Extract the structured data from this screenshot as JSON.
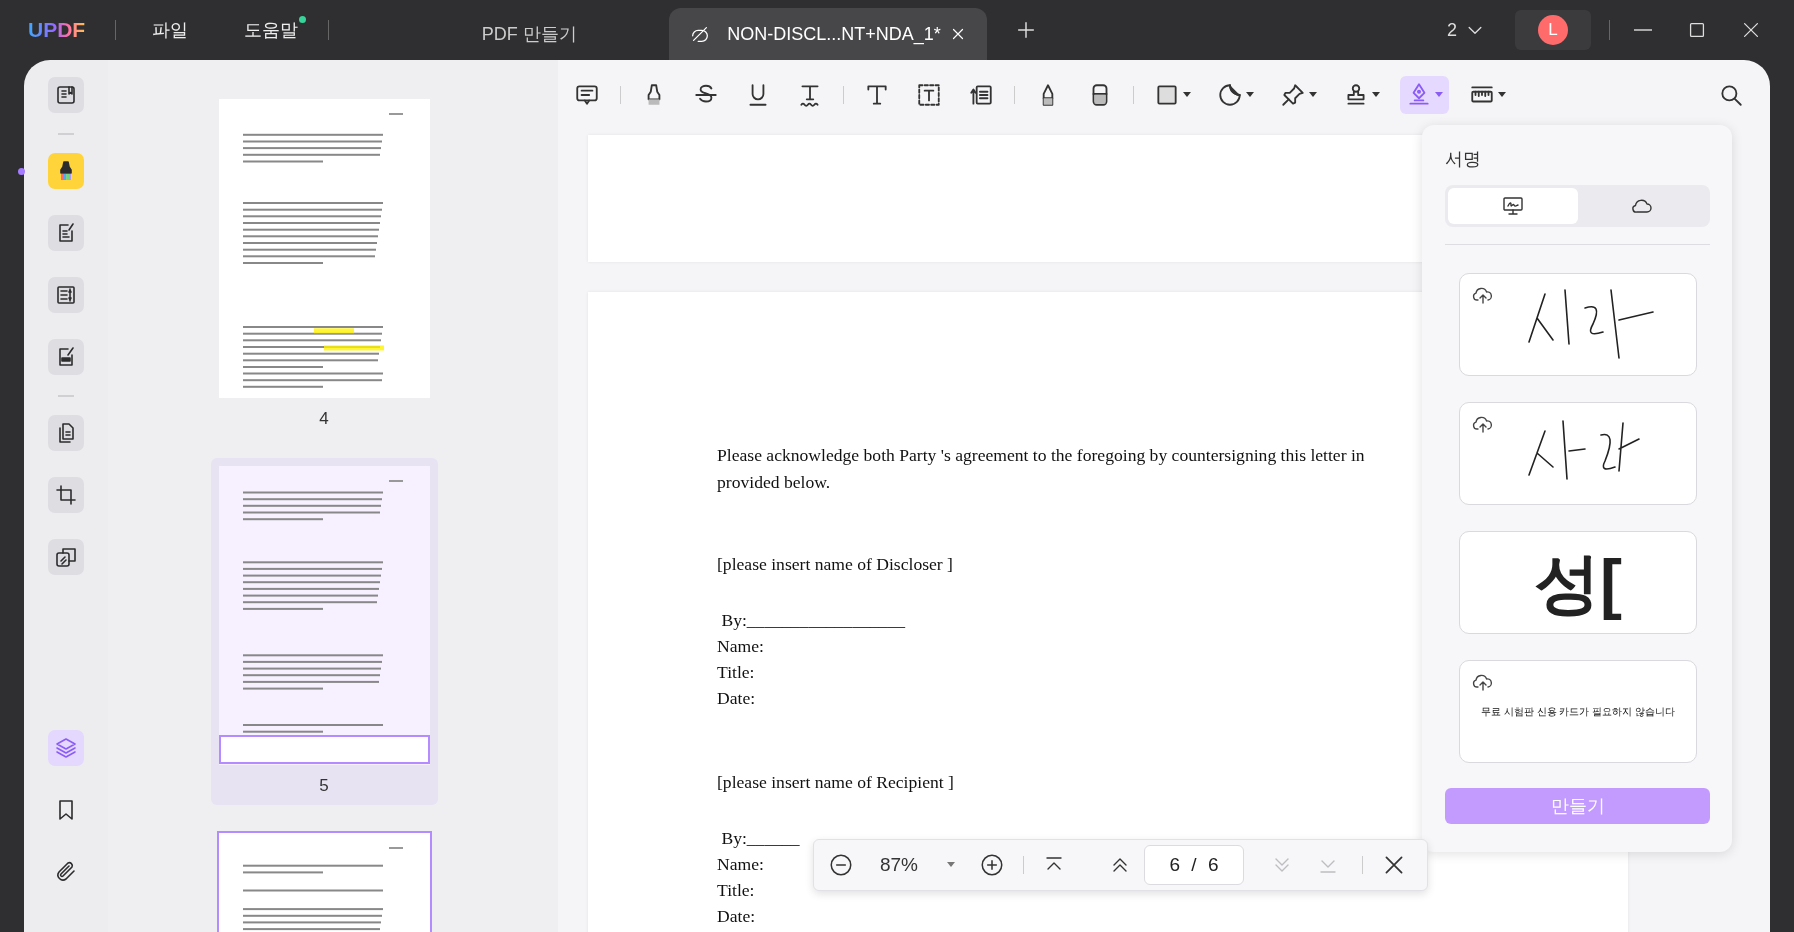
{
  "titlebar": {
    "logo": "UPDF",
    "menus": [
      {
        "label": "파일",
        "badge": false
      },
      {
        "label": "도움말",
        "badge": true
      }
    ],
    "tabs": [
      {
        "label": "PDF 만들기",
        "selected": false,
        "closable": false
      },
      {
        "label": "NON-DISCL...NT+NDA_1*",
        "selected": true,
        "closable": true
      }
    ],
    "window_count": "2",
    "avatar": "L"
  },
  "rail": {
    "items": [
      {
        "kind": "reader",
        "selected": false
      },
      {
        "kind": "divider"
      },
      {
        "kind": "highlighter",
        "selected": true
      },
      {
        "kind": "edit",
        "selected": false
      },
      {
        "kind": "form",
        "selected": false
      },
      {
        "kind": "redact",
        "selected": false
      },
      {
        "kind": "divider"
      },
      {
        "kind": "organize",
        "selected": false
      },
      {
        "kind": "crop",
        "selected": false
      },
      {
        "kind": "convert",
        "selected": false
      }
    ],
    "bottom": [
      {
        "kind": "layers",
        "selected": true
      },
      {
        "kind": "bookmark",
        "selected": false
      },
      {
        "kind": "attachment",
        "selected": false
      }
    ]
  },
  "thumbnails": [
    {
      "label": "4",
      "selected": false,
      "hovered": false,
      "highlights": true
    },
    {
      "label": "5",
      "selected": false,
      "hovered": true,
      "highlights": false
    },
    {
      "selected": true,
      "hovered": false,
      "highlights": false
    }
  ],
  "toolbar": {
    "tools": [
      {
        "kind": "comment",
        "dropdown": false,
        "selected": false
      },
      {
        "kind": "divider"
      },
      {
        "kind": "highlight",
        "dropdown": false,
        "selected": false
      },
      {
        "kind": "strikethrough",
        "dropdown": false,
        "selected": false
      },
      {
        "kind": "underline",
        "dropdown": false,
        "selected": false
      },
      {
        "kind": "squiggly",
        "dropdown": false,
        "selected": false
      },
      {
        "kind": "divider"
      },
      {
        "kind": "text",
        "dropdown": false,
        "selected": false
      },
      {
        "kind": "textbox",
        "dropdown": false,
        "selected": false
      },
      {
        "kind": "callout",
        "dropdown": false,
        "selected": false
      },
      {
        "kind": "divider"
      },
      {
        "kind": "pencil",
        "dropdown": false,
        "selected": false
      },
      {
        "kind": "eraser",
        "dropdown": false,
        "selected": false
      },
      {
        "kind": "divider"
      },
      {
        "kind": "shape",
        "dropdown": true,
        "selected": false
      },
      {
        "kind": "sticker",
        "dropdown": true,
        "selected": false
      },
      {
        "kind": "pin",
        "dropdown": true,
        "selected": false
      },
      {
        "kind": "stamp",
        "dropdown": true,
        "selected": false
      },
      {
        "kind": "signature",
        "dropdown": true,
        "selected": true
      },
      {
        "kind": "measure",
        "dropdown": true,
        "selected": false
      }
    ]
  },
  "letter": {
    "intro": [
      "Please acknowledge both Party 's agreement to the foregoing by countersigning this letter in",
      "provided below."
    ],
    "parties": [
      {
        "heading": "[please insert name of Discloser ]",
        "fields": [
          " By:__________________",
          "Name:",
          "Title:",
          "Date:"
        ]
      },
      {
        "heading": "[please insert name of Recipient ]",
        "fields": [
          " By:______",
          "Name:",
          "Title:",
          "Date:"
        ]
      }
    ]
  },
  "signature_panel": {
    "title": "서명",
    "tabs": [
      {
        "kind": "device",
        "selected": true
      },
      {
        "kind": "cloud",
        "selected": false
      }
    ],
    "signatures": [
      {
        "kind": "handwritten",
        "cloud_upload": true
      },
      {
        "kind": "handwritten",
        "cloud_upload": true
      },
      {
        "kind": "typed",
        "text": "성[",
        "cloud_upload": false
      },
      {
        "kind": "typed-small",
        "text": "무료 시험판 신용 카드가 필요하지 않습니다",
        "cloud_upload": true
      }
    ],
    "create_button": "만들기"
  },
  "zoom_bar": {
    "zoom": "87%",
    "page": "6 / 6",
    "nav": [
      {
        "kind": "first",
        "disabled": false
      },
      {
        "kind": "prev",
        "disabled": false
      },
      {
        "kind": "next",
        "disabled": true
      },
      {
        "kind": "last",
        "disabled": true
      }
    ]
  }
}
